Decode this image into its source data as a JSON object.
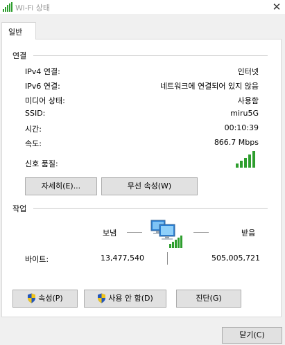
{
  "window": {
    "title": "Wi-Fi 상태",
    "close_glyph": "✕"
  },
  "tabs": [
    {
      "label": "일반"
    }
  ],
  "connection": {
    "header": "연결",
    "rows": [
      {
        "label": "IPv4 연결:",
        "value": "인터넷"
      },
      {
        "label": "IPv6 연결:",
        "value": "네트워크에 연결되어 있지 않음"
      },
      {
        "label": "미디어 상태:",
        "value": "사용함"
      },
      {
        "label": "SSID:",
        "value": "miru5G"
      },
      {
        "label": "시간:",
        "value": "00:10:39"
      },
      {
        "label": "속도:",
        "value": "866.7 Mbps"
      }
    ],
    "signal": {
      "label": "신호 품질:",
      "bars_lit": 5,
      "bars_total": 5,
      "icon": "signal-strength-icon"
    },
    "buttons": {
      "details": "자세히(E)...",
      "wireless_properties": "무선 속성(W)"
    }
  },
  "activity": {
    "header": "작업",
    "sent_label": "보냄",
    "received_label": "받음",
    "bytes_label": "바이트:",
    "bytes_sent": "13,477,540",
    "bytes_received": "505,005,721",
    "icon": "network-computers-icon"
  },
  "bottom_buttons": {
    "properties": "속성(P)",
    "disable": "사용 안 함(D)",
    "diagnose": "진단(G)"
  },
  "footer": {
    "close": "닫기(C)"
  },
  "colors": {
    "signal_green": "#2e9e2e",
    "monitor_blue": "#2a7fd4",
    "shield_blue": "#2456b8",
    "shield_yellow": "#f0c419"
  }
}
